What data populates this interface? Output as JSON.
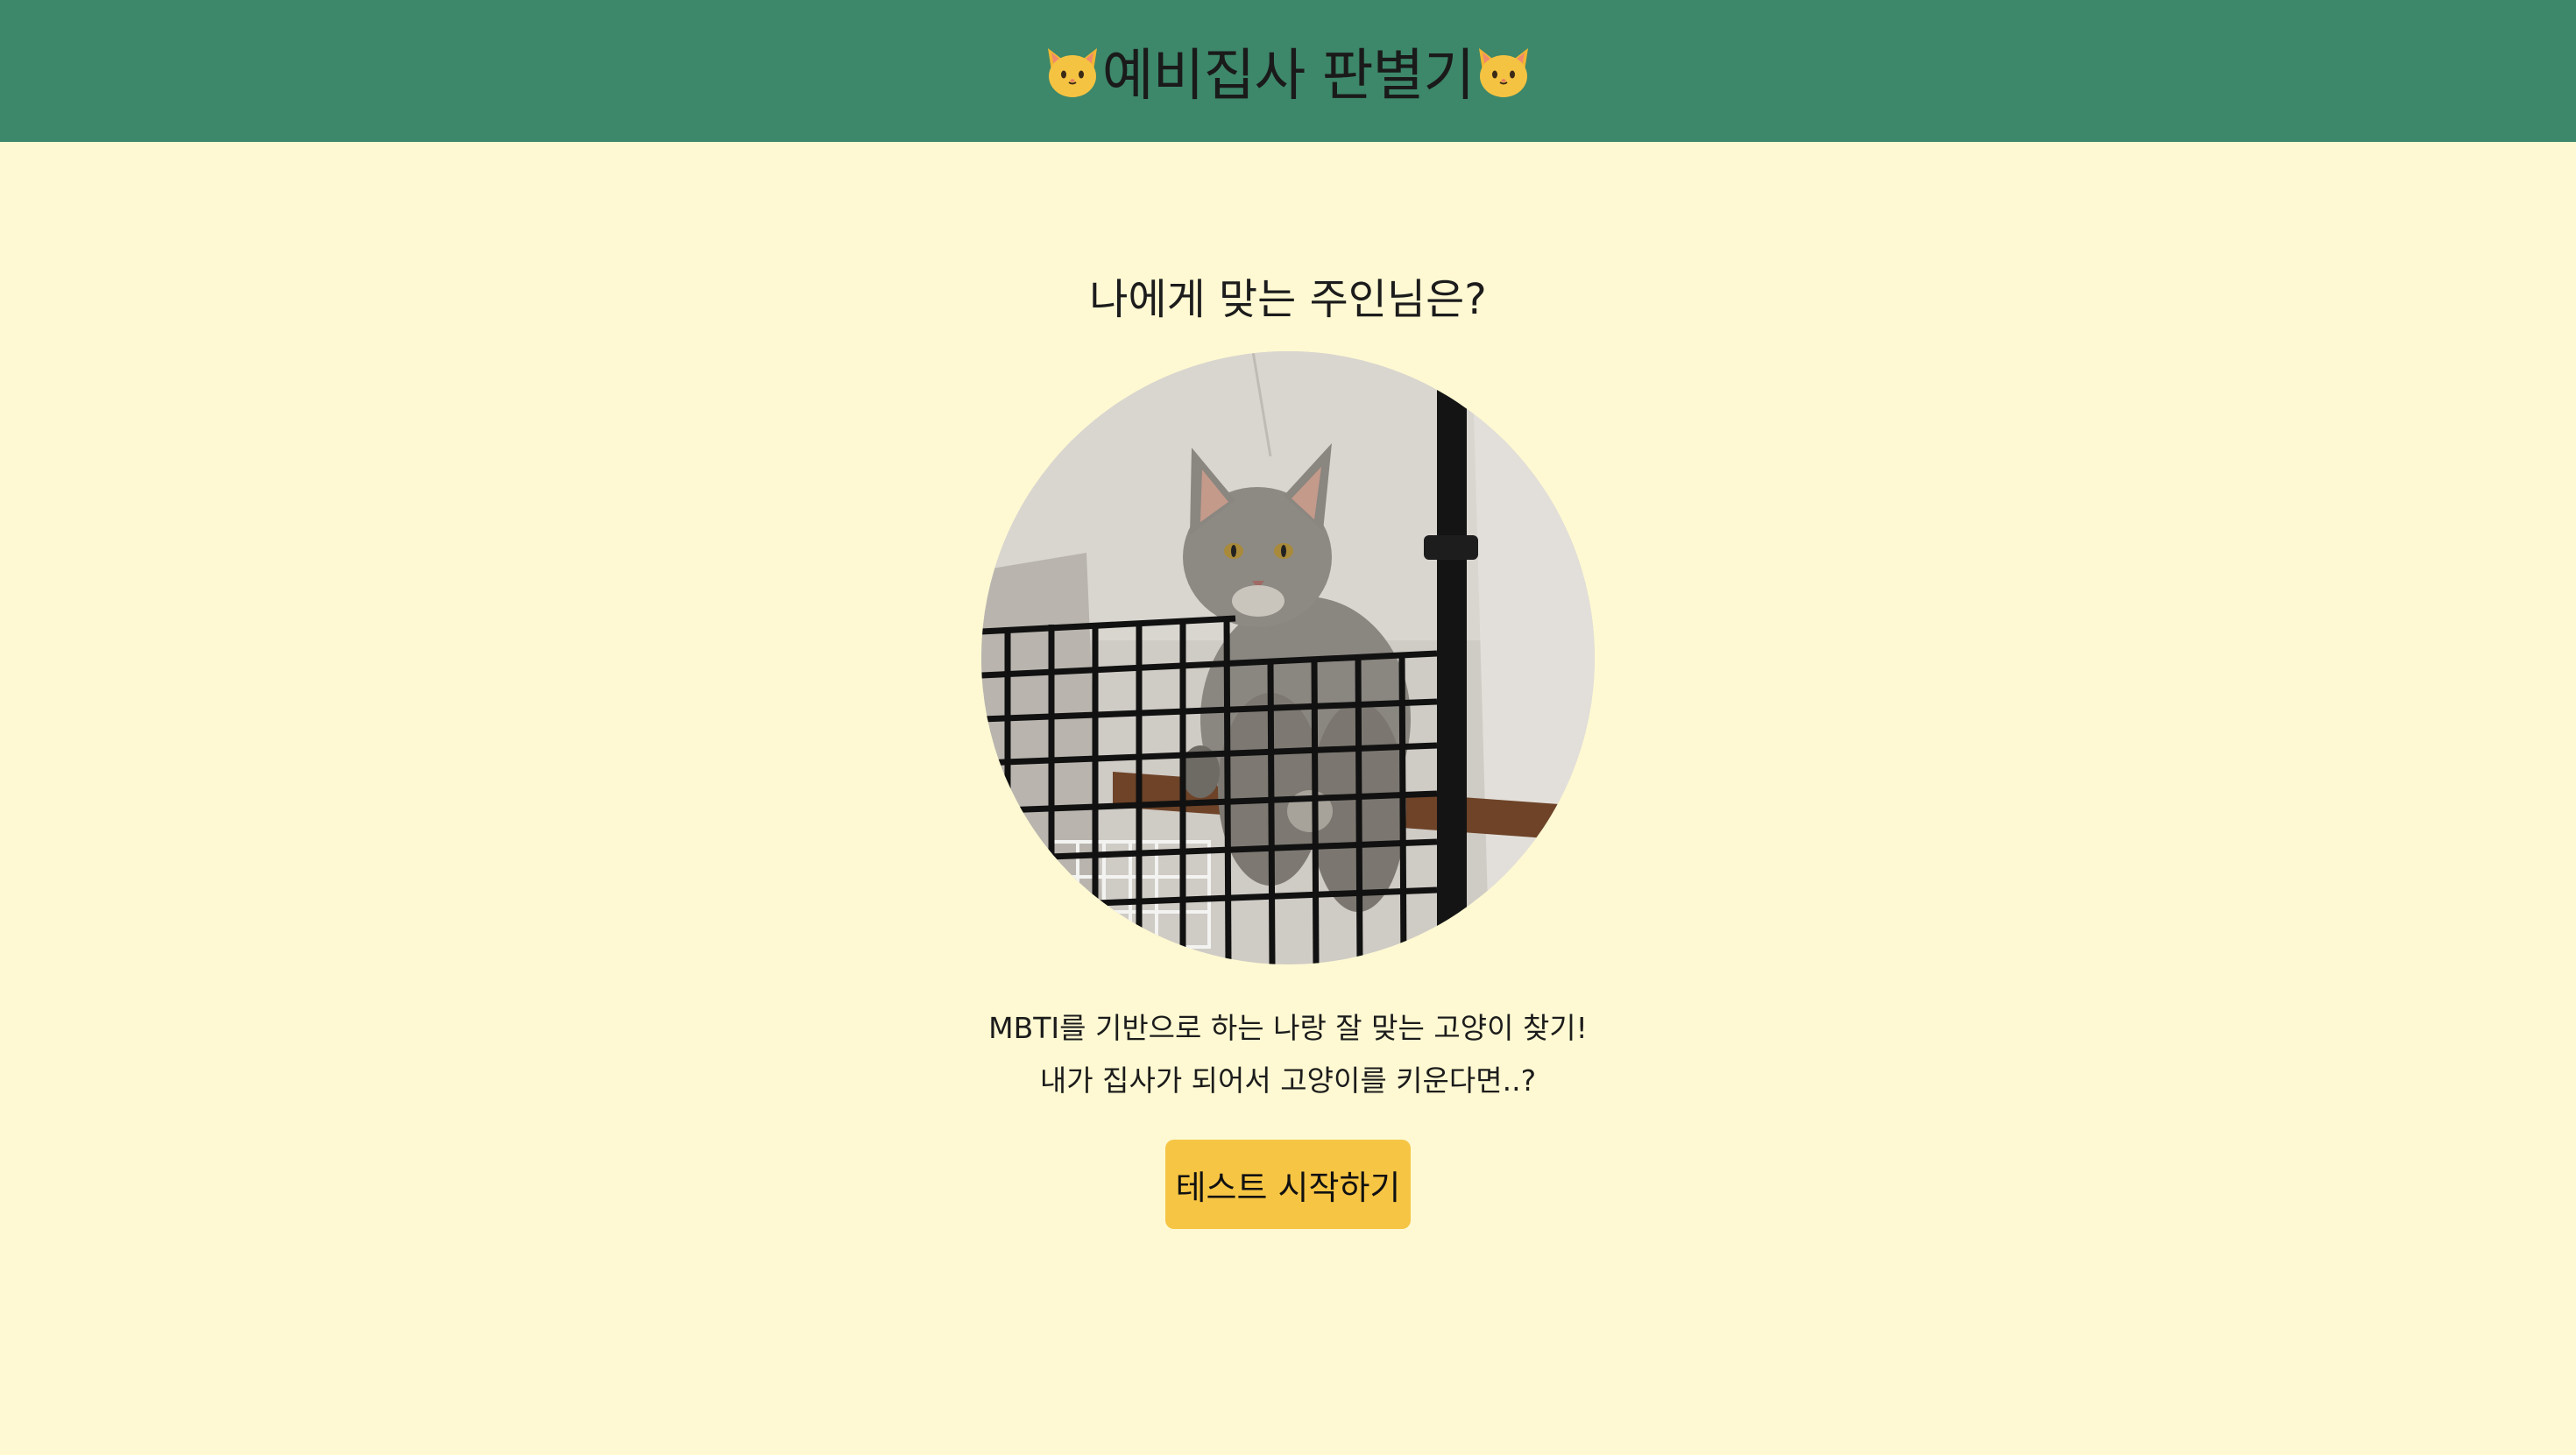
{
  "header": {
    "title": "예비집사 판별기",
    "left_icon": "cat-face-icon",
    "right_icon": "cat-face-icon",
    "background_color": "#3d876a"
  },
  "main": {
    "question": "나에게 맞는 주인님은?",
    "photo_icon": "cat-photo",
    "description_line1": "MBTI를 기반으로 하는 나랑 잘 맞는 고양이 찾기!",
    "description_line2": "내가 집사가 되어서 고양이를 키운다면..?",
    "start_button_label": "테스트 시작하기",
    "background_color": "#fef9d2",
    "button_color": "#f6c544"
  }
}
